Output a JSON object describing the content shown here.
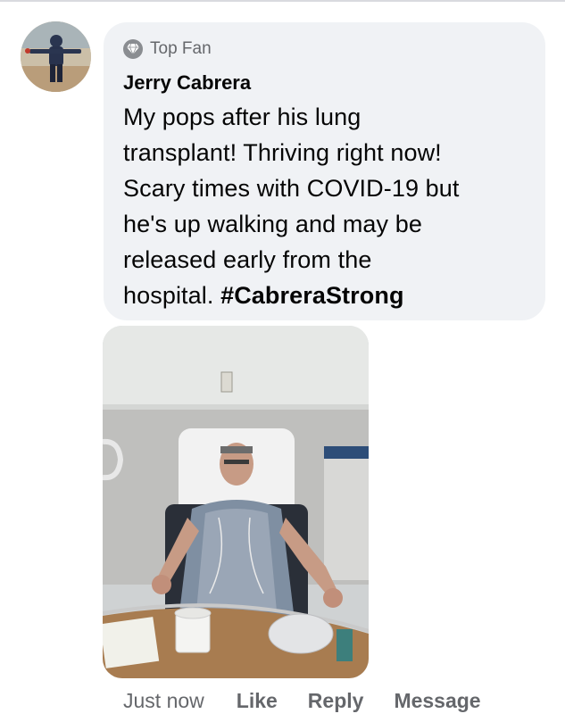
{
  "comment": {
    "badge": {
      "icon": "diamond-icon",
      "label": "Top Fan"
    },
    "author": "Jerry Cabrera",
    "text_lines": [
      "My pops after his lung",
      "transplant! Thriving right now!",
      "Scary times with COVID-19 but",
      "he's up walking and may be",
      "released early from the",
      "hospital. "
    ],
    "hashtag": "#CabreraStrong"
  },
  "footer": {
    "timestamp": "Just now",
    "like_label": "Like",
    "reply_label": "Reply",
    "message_label": "Message"
  },
  "colors": {
    "bubble_background": "#f0f2f5",
    "secondary_text": "#65676b",
    "primary_text": "#050505"
  }
}
